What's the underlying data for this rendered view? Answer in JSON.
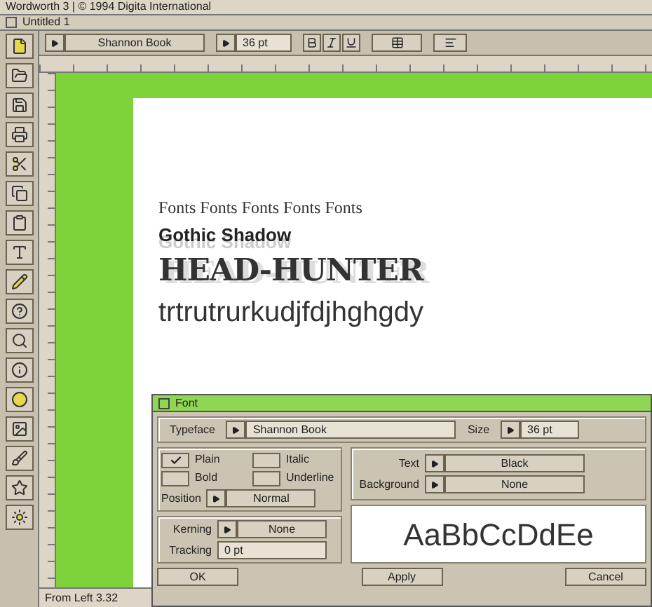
{
  "app_title": "Wordworth 3 | © 1994 Digita International",
  "document": {
    "title": "Untitled 1"
  },
  "toolbar": {
    "font": "Shannon Book",
    "size": "36 pt"
  },
  "page_lines": [
    {
      "kind": "serif",
      "text": "Fonts Fonts Fonts Fonts Fonts"
    },
    {
      "kind": "shadow",
      "text": "Gothic Shadow"
    },
    {
      "kind": "headline",
      "text": "HEAD-HUNTER"
    },
    {
      "kind": "sans",
      "text": "trtrutrurkudjfdjhghgdy"
    }
  ],
  "status_bar": "From Left 3.32",
  "font_dialog": {
    "title": "Font",
    "typeface_label": "Typeface",
    "typeface": "Shannon Book",
    "size_label": "Size",
    "size": "36 pt",
    "styles": [
      {
        "label": "Plain",
        "checked": true
      },
      {
        "label": "Italic",
        "checked": false
      },
      {
        "label": "Bold",
        "checked": false
      },
      {
        "label": "Underline",
        "checked": false
      }
    ],
    "position_label": "Position",
    "position": "Normal",
    "text_label": "Text",
    "text_color": "Black",
    "background_label": "Background",
    "background": "None",
    "kerning_label": "Kerning",
    "kerning": "None",
    "tracking_label": "Tracking",
    "tracking": "0 pt",
    "preview": "AaBbCcDdEe",
    "buttons": [
      "OK",
      "Apply",
      "Cancel"
    ]
  }
}
